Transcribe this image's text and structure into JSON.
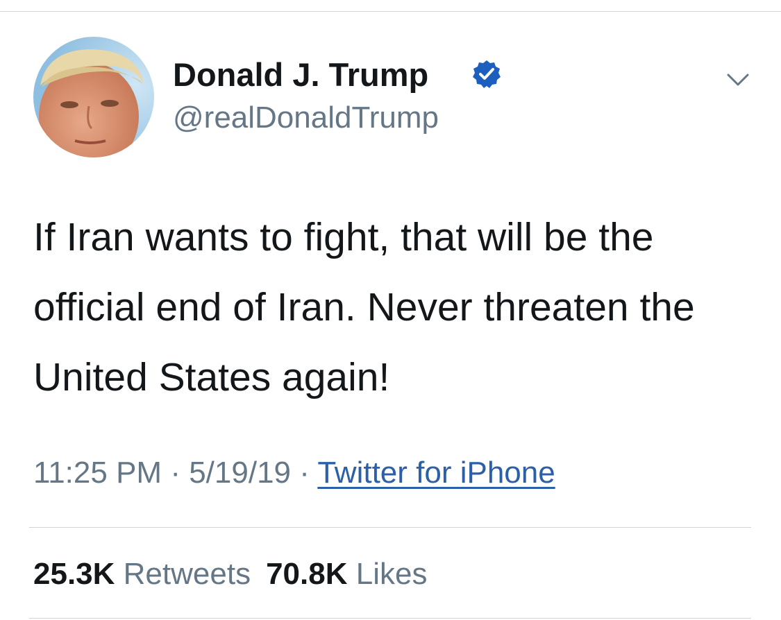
{
  "author": {
    "display_name": "Donald J. Trump",
    "handle": "@realDonaldTrump",
    "verified_icon": "verified-badge-icon",
    "avatar_icon": "profile-avatar"
  },
  "tweet": {
    "text": "If Iran wants to fight, that will be the official end of Iran. Never threaten the United States again!",
    "time": "11:25 PM",
    "separator": "·",
    "date": "5/19/19",
    "source": "Twitter for iPhone"
  },
  "stats": {
    "retweets_count": "25.3K",
    "retweets_label": "Retweets",
    "likes_count": "70.8K",
    "likes_label": "Likes"
  },
  "icons": {
    "menu": "chevron-down-icon"
  },
  "colors": {
    "text_primary": "#14171a",
    "text_secondary": "#657786",
    "link": "#2b5fa8",
    "verified": "#1d5fbf",
    "divider": "#cfd4d9"
  }
}
